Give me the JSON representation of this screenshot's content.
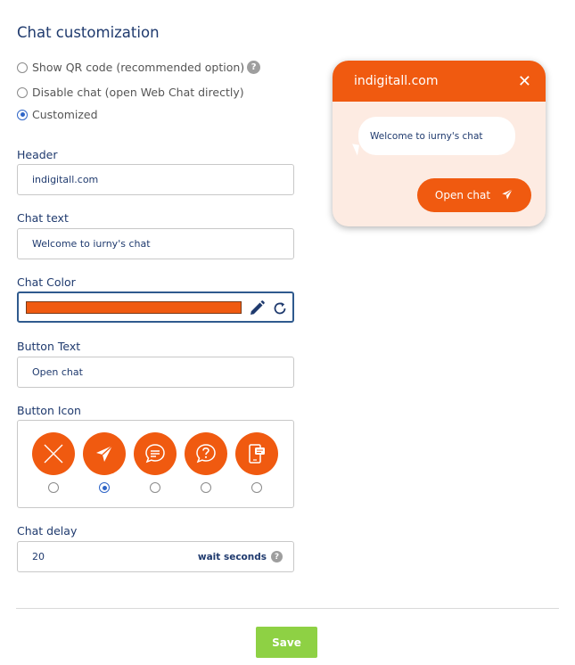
{
  "page": {
    "title": "Chat customization"
  },
  "options": [
    {
      "label": "Show QR code (recommended option)",
      "checked": false,
      "help": "?"
    },
    {
      "label": "Disable chat (open Web Chat directly)",
      "checked": false
    },
    {
      "label": "Customized",
      "checked": true
    }
  ],
  "fields": {
    "header": {
      "label": "Header",
      "value": "indigitall.com"
    },
    "chat_text": {
      "label": "Chat text",
      "value": "Welcome to iurny's chat"
    },
    "chat_color": {
      "label": "Chat Color",
      "value": "#f05a10"
    },
    "button_text": {
      "label": "Button Text",
      "value": "Open chat"
    },
    "button_icon": {
      "label": "Button Icon",
      "icons": [
        "close-icon",
        "send-icon",
        "chat-bubble-icon",
        "question-bubble-icon",
        "phone-message-icon"
      ],
      "selected_index": 1
    },
    "chat_delay": {
      "label": "Chat delay",
      "value": "20",
      "unit": "wait seconds",
      "help": "?"
    }
  },
  "actions": {
    "save": "Save"
  },
  "preview": {
    "header": "indigitall.com",
    "close": "✕",
    "message": "Welcome to iurny's chat",
    "button": "Open chat"
  },
  "colors": {
    "accent": "#f05a10",
    "preview_bg": "#fdebe2",
    "text": "#1f3a6e",
    "save": "#8ed144"
  }
}
